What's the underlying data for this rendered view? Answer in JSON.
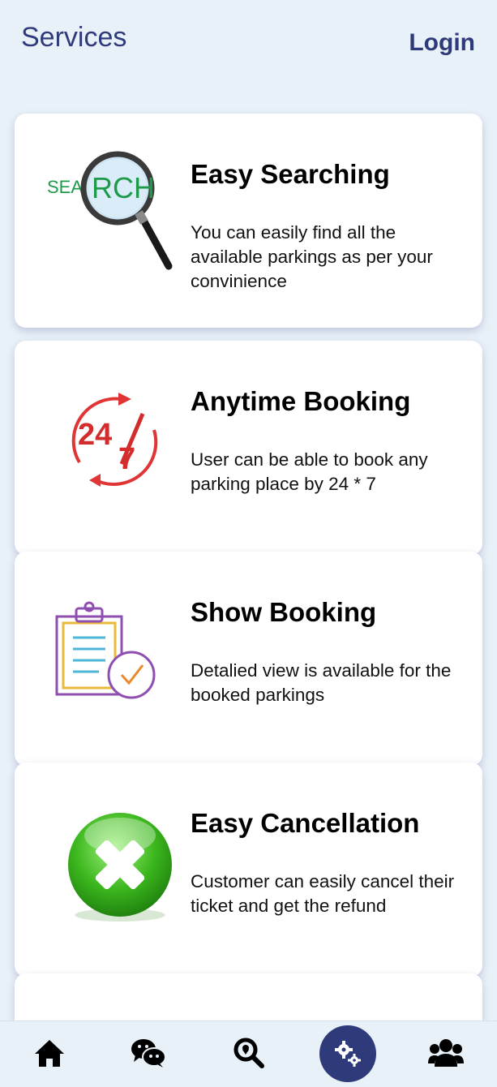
{
  "header": {
    "title": "Services",
    "login_label": "Login"
  },
  "services": [
    {
      "title": "Easy Searching",
      "description": "You can easily find all the available parkings as per your convinience",
      "icon": "search-magnifier-icon",
      "icon_text_left": "SEA",
      "icon_text_right": "RCH"
    },
    {
      "title": "Anytime Booking",
      "description": "User can be able to book any parking place by 24 * 7",
      "icon": "clock-24-7-icon",
      "icon_text_top": "24",
      "icon_text_bottom": "7"
    },
    {
      "title": "Show Booking",
      "description": "Detalied view is available for the booked parkings",
      "icon": "clipboard-check-icon"
    },
    {
      "title": "Easy Cancellation",
      "description": "Customer can easily cancel their ticket and get the refund",
      "icon": "cancel-x-icon"
    }
  ],
  "bottom_nav": {
    "items": [
      {
        "name": "home",
        "icon": "home-icon"
      },
      {
        "name": "chat",
        "icon": "chat-icon"
      },
      {
        "name": "search",
        "icon": "search-location-icon"
      },
      {
        "name": "services",
        "icon": "gears-icon",
        "active": true
      },
      {
        "name": "users",
        "icon": "users-icon"
      }
    ]
  },
  "colors": {
    "background": "#e8f1f8",
    "accent": "#2e3a7a",
    "card": "#ffffff"
  }
}
